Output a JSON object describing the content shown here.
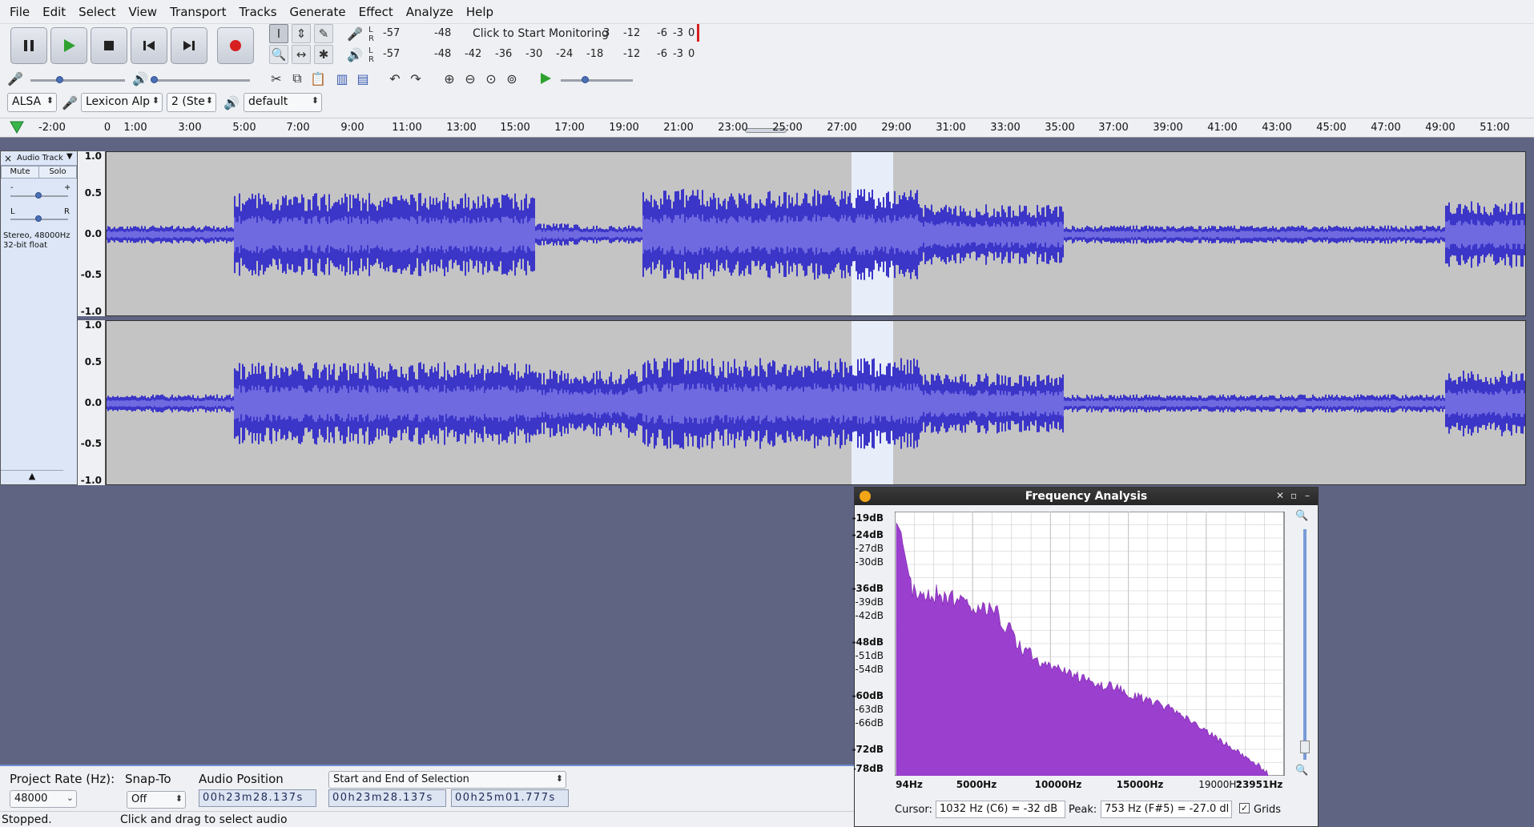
{
  "menu": [
    "File",
    "Edit",
    "Select",
    "View",
    "Transport",
    "Tracks",
    "Generate",
    "Effect",
    "Analyze",
    "Help"
  ],
  "transport": {
    "pause_icon": "pause-icon",
    "play_icon": "play-icon",
    "stop_icon": "stop-icon",
    "skip_start_icon": "skip-to-start-icon",
    "skip_end_icon": "skip-to-end-icon",
    "record_icon": "record-icon"
  },
  "meters": {
    "record_scale": [
      "-57",
      "-48",
      "Click to Start Monitoring",
      "3",
      "-12",
      "-6",
      "-3",
      "0"
    ],
    "play_scale": [
      "-57",
      "-48",
      "-42",
      "-36",
      "-30",
      "-24",
      "-18",
      "-12",
      "-6",
      "-3",
      "0"
    ],
    "lr": [
      "L",
      "R"
    ]
  },
  "device": {
    "host": "ALSA",
    "recording_device": "Lexicon Alp",
    "channels": "2 (Ste",
    "playback_device": "default"
  },
  "ruler_labels": [
    "-2:00",
    "0",
    "1:00",
    "3:00",
    "5:00",
    "7:00",
    "9:00",
    "11:00",
    "13:00",
    "15:00",
    "17:00",
    "19:00",
    "21:00",
    "23:00",
    "25:00",
    "27:00",
    "29:00",
    "31:00",
    "33:00",
    "35:00",
    "37:00",
    "39:00",
    "41:00",
    "43:00",
    "45:00",
    "47:00",
    "49:00",
    "51:00"
  ],
  "track": {
    "name": "Audio Track",
    "mute": "Mute",
    "solo": "Solo",
    "gain_minus": "-",
    "gain_plus": "+",
    "pan_left": "L",
    "pan_right": "R",
    "info_line1": "Stereo, 48000Hz",
    "info_line2": "32-bit float",
    "scale": [
      "1.0",
      "0.5",
      "0.0",
      "-0.5",
      "-1.0"
    ]
  },
  "freq": {
    "title": "Frequency Analysis",
    "y_labels": [
      {
        "t": "-19dB",
        "major": true
      },
      {
        "t": "-24dB",
        "major": true
      },
      {
        "t": "-27dB",
        "major": false
      },
      {
        "t": "-30dB",
        "major": false
      },
      {
        "t": "-36dB",
        "major": true
      },
      {
        "t": "-39dB",
        "major": false
      },
      {
        "t": "-42dB",
        "major": false
      },
      {
        "t": "-48dB",
        "major": true
      },
      {
        "t": "-51dB",
        "major": false
      },
      {
        "t": "-54dB",
        "major": false
      },
      {
        "t": "-60dB",
        "major": true
      },
      {
        "t": "-63dB",
        "major": false
      },
      {
        "t": "-66dB",
        "major": false
      },
      {
        "t": "-72dB",
        "major": true
      },
      {
        "t": "-78dB",
        "major": true
      }
    ],
    "x_labels": [
      {
        "t": "94Hz",
        "major": true
      },
      {
        "t": "5000Hz",
        "major": true
      },
      {
        "t": "10000Hz",
        "major": true
      },
      {
        "t": "15000Hz",
        "major": true
      },
      {
        "t": "19000Hz",
        "major": false
      },
      {
        "t": "23951Hz",
        "major": true
      }
    ],
    "cursor_label": "Cursor:",
    "cursor_value": "1032 Hz (C6) = -32 dB",
    "peak_label": "Peak:",
    "peak_value": "753 Hz (F#5) = -27.0 dl",
    "grids_label": "Grids",
    "grids_checked": true,
    "fill_color": "#9b3fcf"
  },
  "selection_toolbar": {
    "project_rate_label": "Project Rate (Hz):",
    "project_rate": "48000",
    "snap_label": "Snap-To",
    "snap_value": "Off",
    "audio_pos_label": "Audio Position",
    "audio_pos": "00h23m28.137s",
    "sel_mode": "Start and End of Selection",
    "sel_start": "00h23m28.137s",
    "sel_end": "00h25m01.777s"
  },
  "status": {
    "left": "Stopped.",
    "right": "Click and drag to select audio"
  },
  "colors": {
    "waveform": "#3b35c8",
    "waveform_rms": "#6f6ae0",
    "track_bg": "#c4c4c4",
    "selection": "#e8eef9",
    "workspace": "#5f6483"
  }
}
